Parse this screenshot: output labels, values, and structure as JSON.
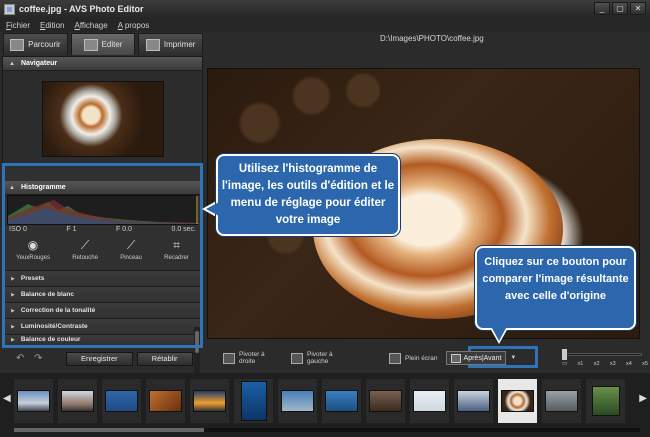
{
  "window": {
    "title": "coffee.jpg - AVS Photo Editor",
    "controls": [
      "_",
      "▢",
      "✕"
    ]
  },
  "menu": [
    "Fichier",
    "Edition",
    "Affichage",
    "A propos"
  ],
  "tabs": [
    {
      "label": "Parcourir",
      "icon": "folder-icon"
    },
    {
      "label": "Editer",
      "icon": "edit-icon",
      "active": true
    },
    {
      "label": "Imprimer",
      "icon": "printer-icon"
    }
  ],
  "file_path": "D:\\Images\\PHOTO\\coffee.jpg",
  "sidebar": {
    "navigator_title": "Navigateur",
    "histogram_title": "Histogramme",
    "histogram_readout": [
      "ISO 0",
      "F 1",
      "F 0.0",
      "0.0 sec."
    ],
    "tools": [
      {
        "label": "YeuxRouges",
        "icon": "eye-icon"
      },
      {
        "label": "Retouche",
        "icon": "brush-icon"
      },
      {
        "label": "Pinceau",
        "icon": "paintbrush-icon"
      },
      {
        "label": "Recadrer",
        "icon": "crop-icon"
      }
    ],
    "settings": [
      "Presets",
      "Balance de blanc",
      "Correction de la tonalité",
      "Luminosité/Contraste",
      "Balance de couleur"
    ]
  },
  "actions": {
    "save": "Enregistrer",
    "reset": "Rétablir"
  },
  "bottom_toolbar": {
    "rotate_right": "Pivoter à droite",
    "rotate_left": "Pivoter à gauche",
    "fullscreen": "Plein écran",
    "compare": "Après|Avant",
    "zoom_labels": [
      "x1",
      "x2",
      "x3",
      "x4",
      "x5"
    ]
  },
  "callouts": {
    "histogram": "Utilisez l'histogramme de l'image, les outils d'édition et le menu de réglage pour éditer votre image",
    "compare": "Cliquez sur ce bouton pour comparer l'image résultante avec celle d'origine"
  },
  "colors": {
    "callout_blue": "#2c67ae",
    "highlight_border": "#2f73b8"
  }
}
